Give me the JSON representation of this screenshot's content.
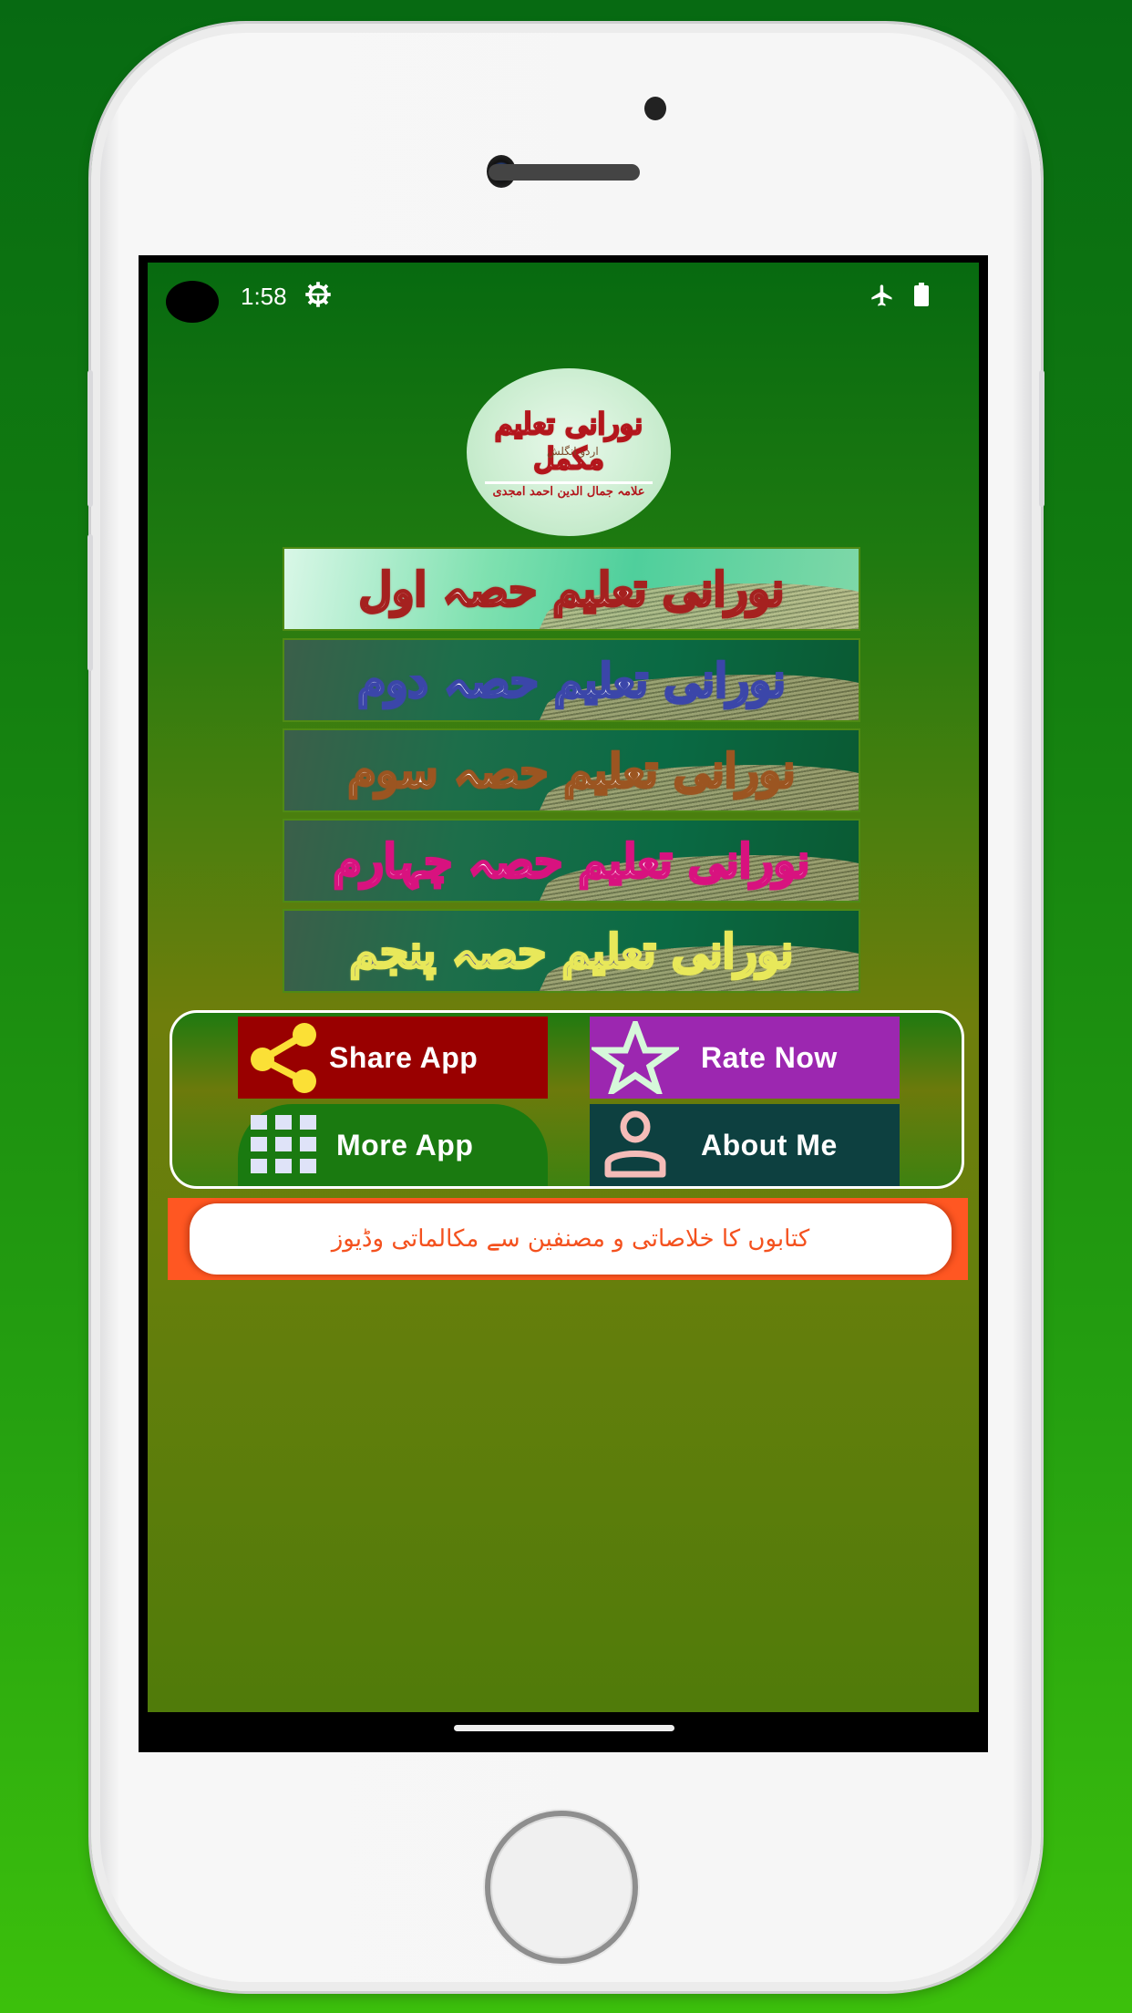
{
  "status_bar": {
    "time": "1:58",
    "icons": [
      "settings-gear-icon",
      "airplane-mode-icon",
      "battery-icon"
    ]
  },
  "logo": {
    "title": "نورانی تعلیم مکمل",
    "subtitle": "اردو انگلش",
    "author": "علامہ جمال الدین احمد امجدی"
  },
  "banners": [
    {
      "label": "نورانی تعلیم حصہ اول",
      "color": "#a5211f"
    },
    {
      "label": "نورانی تعلیم حصہ دوم",
      "color": "#3b46a9"
    },
    {
      "label": "نورانی تعلیم حصہ سوم",
      "color": "#9b5521"
    },
    {
      "label": "نورانی تعلیم حصہ چہارم",
      "color": "#d8127f"
    },
    {
      "label": "نورانی تعلیم حصہ پنجم",
      "color": "#e8e85a"
    }
  ],
  "actions": {
    "share": {
      "label": "Share App",
      "icon": "share-icon",
      "color": "#990000"
    },
    "rate": {
      "label": "Rate Now",
      "icon": "star-icon",
      "color": "#9c27b0"
    },
    "more": {
      "label": "More App",
      "icon": "grid-icon",
      "color": "#1a7a10"
    },
    "about": {
      "label": "About Me",
      "icon": "person-icon",
      "color": "#0d4040"
    }
  },
  "promo": {
    "text": "کتابوں کا خلاصاتی و مصنفین سے مکالماتی وڈیوز",
    "accent": "#ff5722"
  }
}
